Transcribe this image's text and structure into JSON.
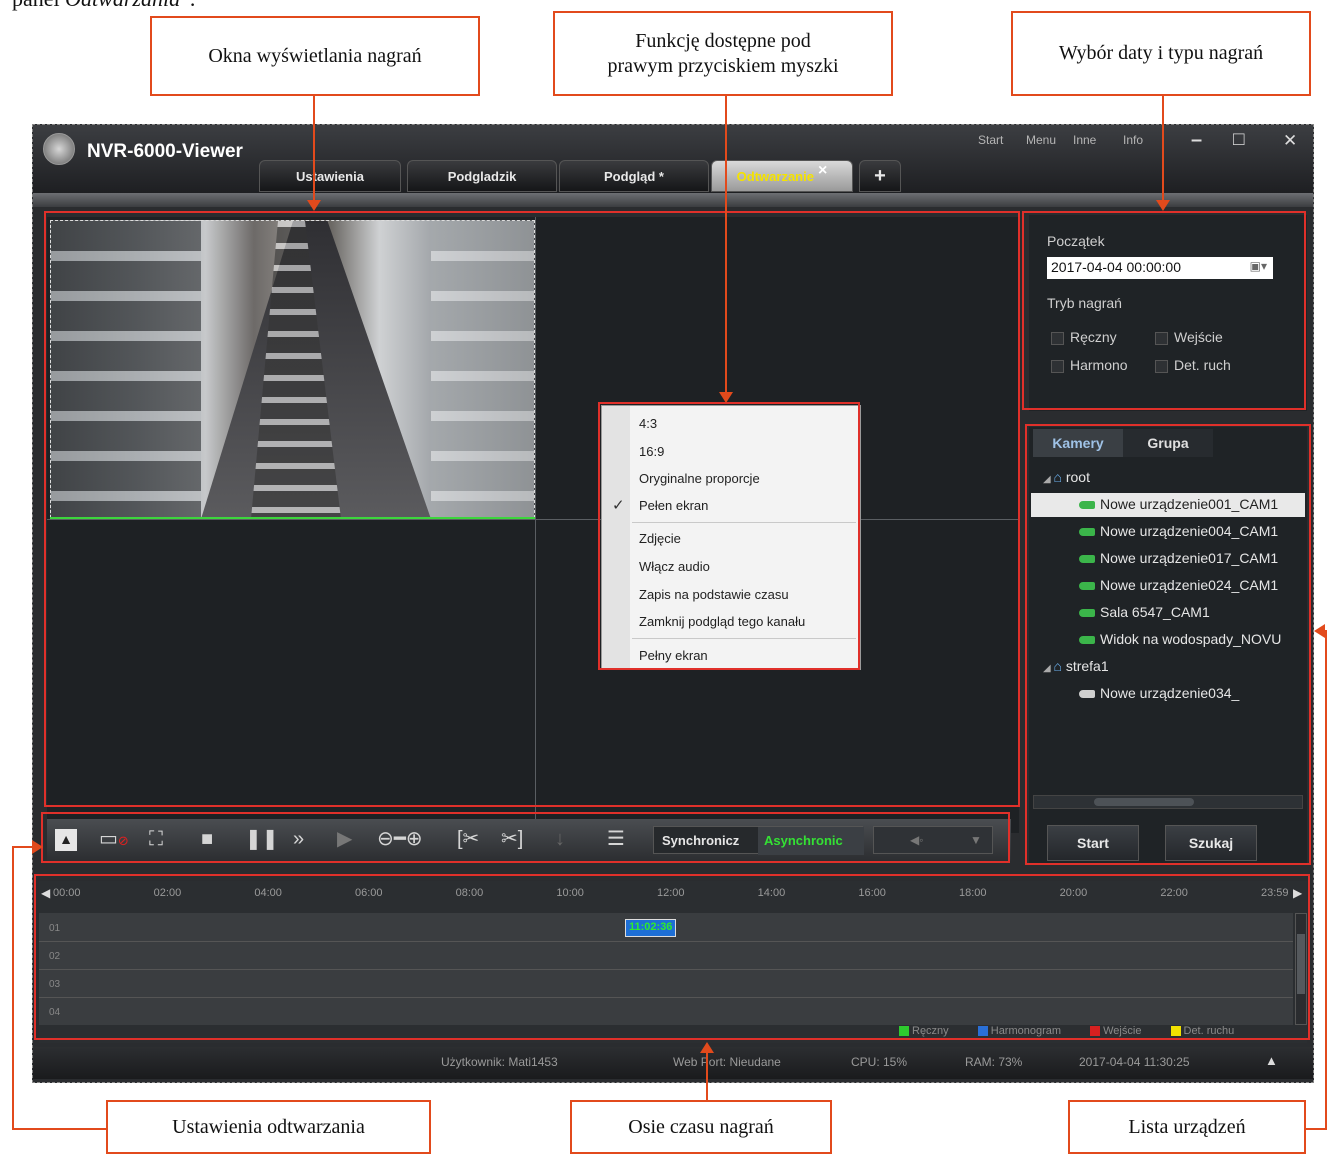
{
  "doc_header": {
    "prefix": "panel ",
    "italic": "Odtwarzania"
  },
  "callouts": {
    "recording_windows": "Okna wyświetlania nagrań",
    "right_click_line1": "Funkcję dostępne pod",
    "right_click_line2": "prawym przyciskiem myszki",
    "date_type": "Wybór daty i typu nagrań",
    "playback_settings": "Ustawienia odtwarzania",
    "timeline_axes": "Osie czasu nagrań",
    "device_list": "Lista urządzeń"
  },
  "app": {
    "title": "NVR-6000-Viewer",
    "top_menu": [
      "Start",
      "Menu",
      "Inne",
      "Info"
    ],
    "tabs": [
      {
        "label": "Ustawienia",
        "active": false
      },
      {
        "label": "Podgladzik",
        "active": false
      },
      {
        "label": "Podgląd *",
        "active": false
      },
      {
        "label": "Odtwarzanie",
        "active": true
      }
    ],
    "tab_close": "×",
    "add_tab": "+",
    "window_controls": {
      "minimize": "–",
      "maximize": "□",
      "close": "✕"
    }
  },
  "context_menu": {
    "items": [
      "4:3",
      "16:9",
      "Oryginalne proporcje",
      "Pełen ekran",
      "Zdjęcie",
      "Włącz audio",
      "Zapis na podstawie czasu",
      "Zamknij podgląd tego kanału",
      "Pełny ekran"
    ],
    "checked": "Pełen ekran"
  },
  "date_panel": {
    "start_label": "Początek",
    "start_value": "2017-04-04 00:00:00",
    "mode_label": "Tryb nagrań",
    "modes": [
      "Ręczny",
      "Wejście",
      "Harmono",
      "Det. ruch"
    ]
  },
  "device_panel": {
    "tabs": [
      "Kamery",
      "Grupa"
    ],
    "groups": [
      {
        "name": "root",
        "items": [
          "Nowe urządzenie001_CAM1",
          "Nowe urządzenie004_CAM1",
          "Nowe urządzenie017_CAM1",
          "Nowe urządzenie024_CAM1",
          "Sala 6547_CAM1",
          "Widok na wodospady_NOVU"
        ]
      },
      {
        "name": "strefa1",
        "items": [
          "Nowe urządzenie034_"
        ]
      }
    ],
    "start_button": "Start",
    "search_button": "Szukaj"
  },
  "controls": {
    "sync_label": "Synchronicz",
    "async_label": "Asynchronic"
  },
  "timeline": {
    "ticks": [
      "00:00",
      "02:00",
      "04:00",
      "06:00",
      "08:00",
      "10:00",
      "12:00",
      "14:00",
      "16:00",
      "18:00",
      "20:00",
      "22:00",
      "23:59"
    ],
    "rows": [
      "01",
      "02",
      "03",
      "04"
    ],
    "marker": "11:02:36",
    "legend": [
      {
        "label": "Ręczny",
        "color": "#2ec92e"
      },
      {
        "label": "Harmonogram",
        "color": "#2a6fd6"
      },
      {
        "label": "Wejście",
        "color": "#d62020"
      },
      {
        "label": "Det. ruchu",
        "color": "#f2e100"
      }
    ]
  },
  "status_bar": {
    "user": "Użytkownik: Mati1453",
    "web_port": "Web Port: Nieudane",
    "cpu": "CPU: 15%",
    "ram": "RAM: 73%",
    "datetime": "2017-04-04 11:30:25"
  }
}
